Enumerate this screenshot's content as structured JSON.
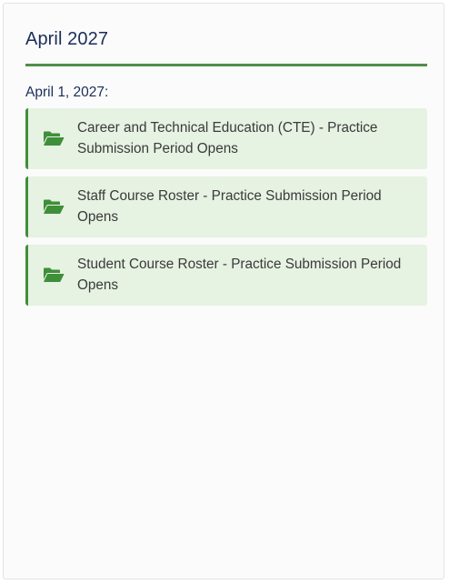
{
  "month": {
    "title": "April 2027"
  },
  "day": {
    "heading": "April 1, 2027:"
  },
  "events": [
    {
      "label": "Career and Technical Education (CTE) - Practice Submission Period Opens",
      "icon": "folder-open-icon"
    },
    {
      "label": "Staff Course Roster - Practice Submission Period Opens",
      "icon": "folder-open-icon"
    },
    {
      "label": "Student Course Roster - Practice Submission Period Opens",
      "icon": "folder-open-icon"
    }
  ],
  "colors": {
    "title": "#1a2e5a",
    "accent_green": "#3f8f3a",
    "event_background": "#e6f2e2",
    "icon_green": "#3f8f3a"
  }
}
